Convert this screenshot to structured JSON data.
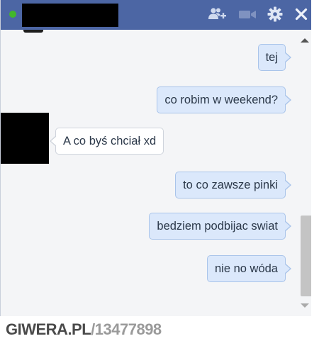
{
  "window": {
    "title": "",
    "online_color": "#42b72a",
    "accent": "#4c66a4",
    "icons": {
      "add_people": "add-people-icon",
      "video_call": "video-camera-icon",
      "settings": "gear-icon",
      "close": "close-icon"
    }
  },
  "messages": [
    {
      "sender": "me",
      "text": "tej"
    },
    {
      "sender": "me",
      "text": "co robim w weekend?"
    },
    {
      "sender": "them",
      "text": "A co byś chciał xd"
    },
    {
      "sender": "me",
      "text": "to co zawsze pinki"
    },
    {
      "sender": "me",
      "text": "bedziem podbijac swiat"
    },
    {
      "sender": "me",
      "text": "nie no wóda"
    }
  ],
  "watermark": {
    "site": "GIWERA.PL",
    "id": "/13477898"
  }
}
